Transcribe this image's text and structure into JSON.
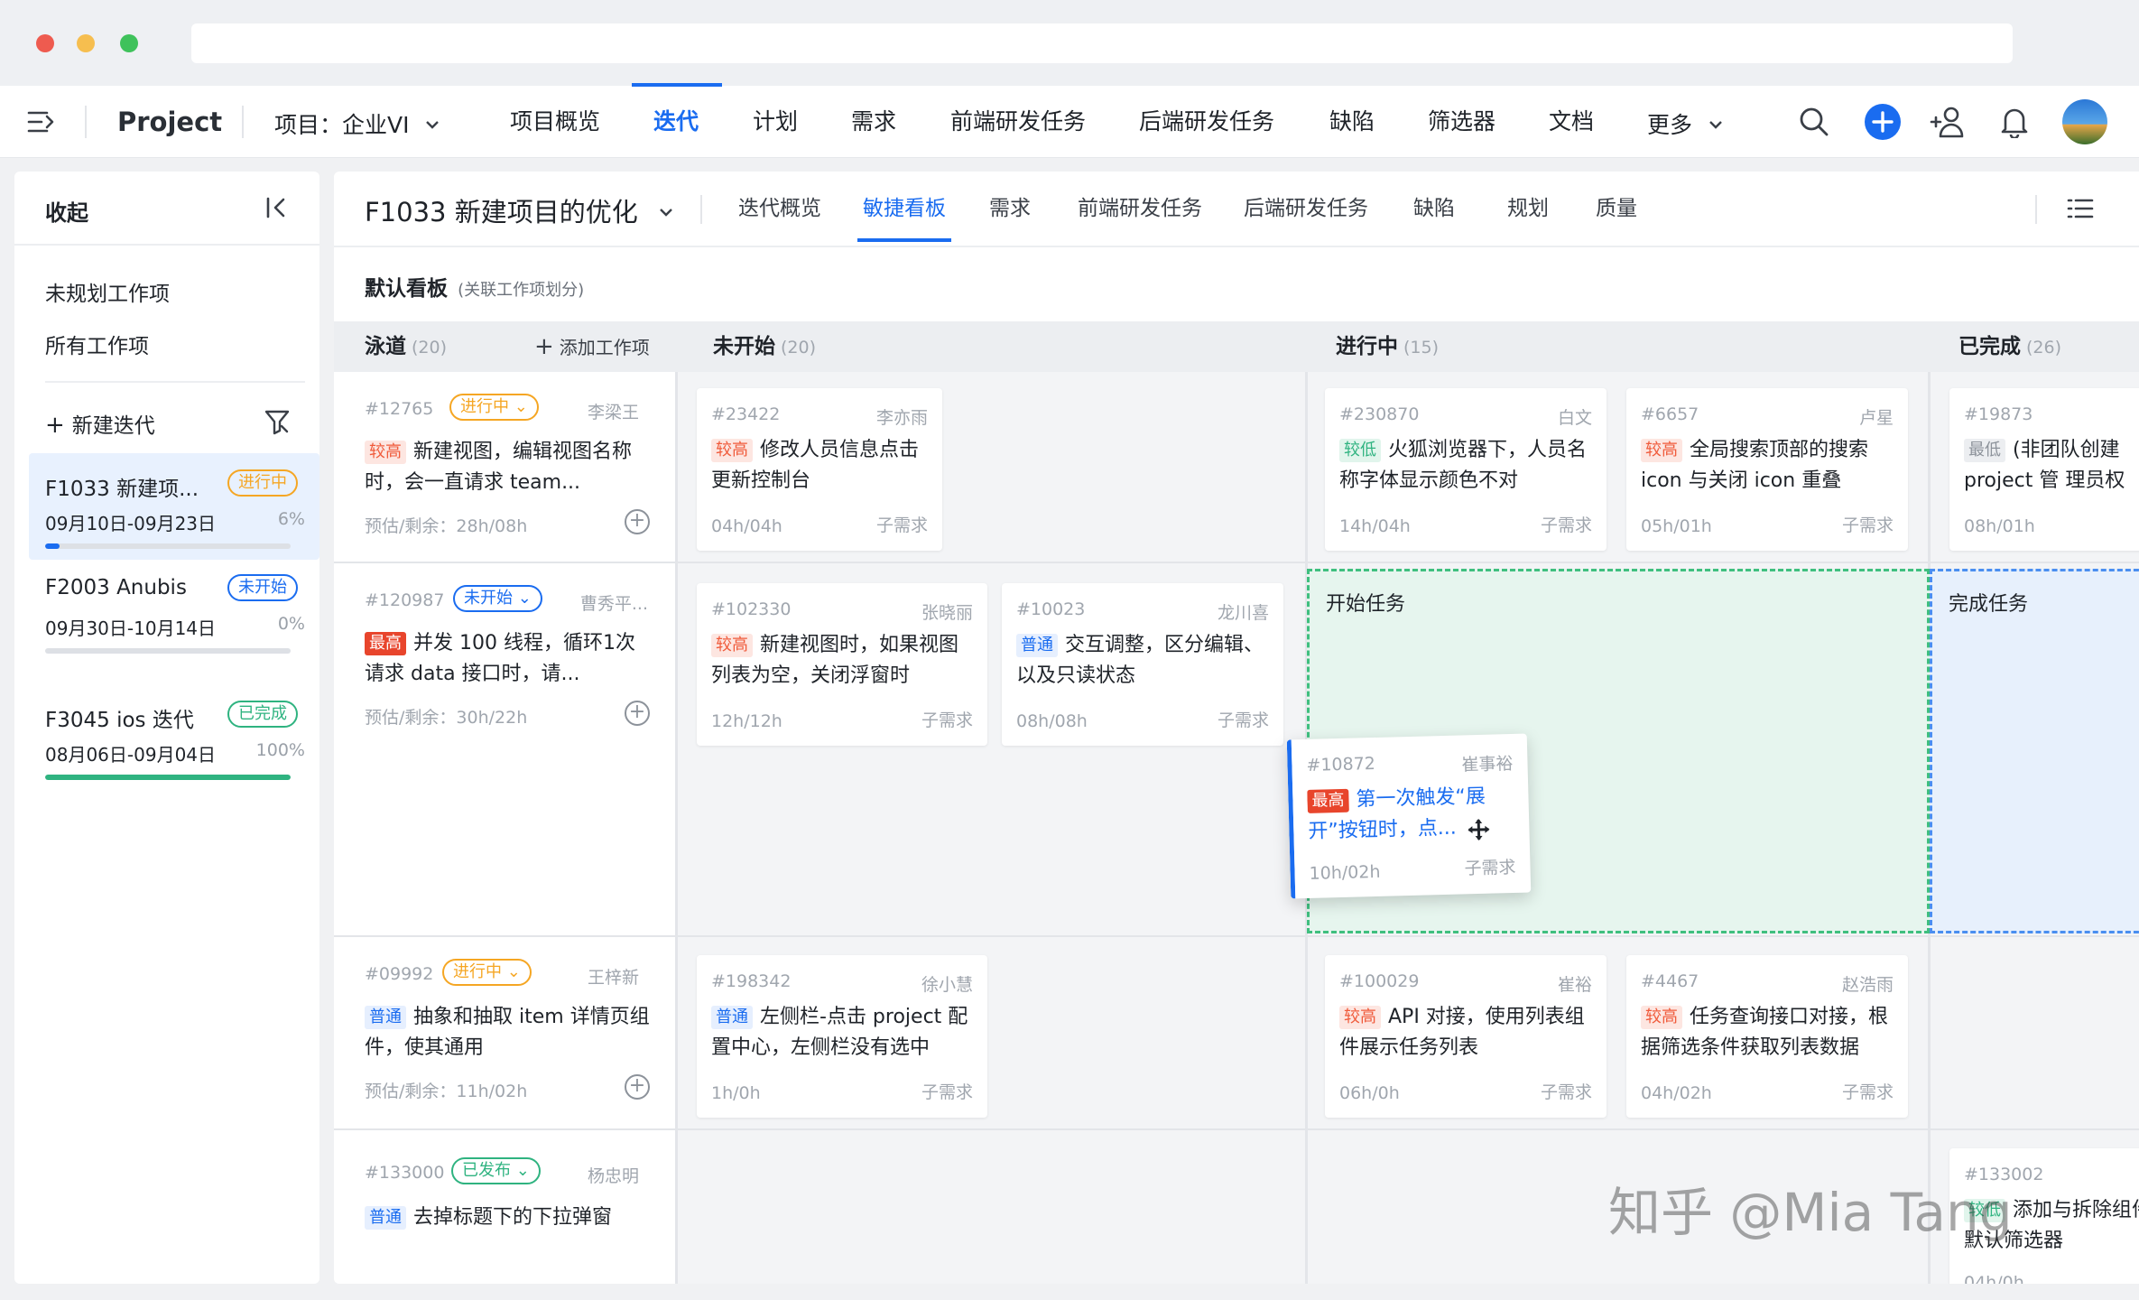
{
  "topnav": {
    "product": "Project",
    "project_selector": "项目：企业VI",
    "items": [
      "项目概览",
      "迭代",
      "计划",
      "需求",
      "前端研发任务",
      "后端研发任务",
      "缺陷",
      "筛选器",
      "文档",
      "更多"
    ],
    "active_item": "迭代",
    "accent": "#1a6cf0"
  },
  "sidebar": {
    "collapse_label": "收起",
    "links": [
      "未规划工作项",
      "所有工作项"
    ],
    "new_iteration": "新建迭代",
    "iterations": [
      {
        "name": "F1033 新建项...",
        "status": "进行中",
        "dates": "09月10日-09月23日",
        "percent": "6%",
        "progress": 0.06,
        "color": "#f5a623"
      },
      {
        "name": "F2003 Anubis",
        "status": "未开始",
        "dates": "09月30日-10月14日",
        "percent": "0%",
        "progress": 0,
        "color": "#1a6cf0"
      },
      {
        "name": "F3045 ios 迭代",
        "status": "已完成",
        "dates": "08月06日-09月04日",
        "percent": "100%",
        "progress": 1,
        "color": "#2fb380"
      }
    ]
  },
  "main": {
    "iteration_title": "F1033 新建项目的优化",
    "tabs": [
      "迭代概览",
      "敏捷看板",
      "需求",
      "前端研发任务",
      "后端研发任务",
      "缺陷",
      "规划",
      "质量"
    ],
    "active_tab": "敏捷看板",
    "board_title": "默认看板",
    "board_subtitle": "(关联工作项划分)"
  },
  "board": {
    "swimlane_header": "泳道",
    "swimlane_count": "(20)",
    "add_item": "添加工作项",
    "columns": [
      {
        "name": "未开始",
        "count": "(20)"
      },
      {
        "name": "进行中",
        "count": "(15)"
      },
      {
        "name": "已完成",
        "count": "(26)"
      }
    ],
    "lanes": [
      {
        "id": "#12765",
        "status": "进行中",
        "status_color": "#f5a623",
        "user": "李梁王",
        "priority": "较高",
        "pri_class": "pri-high",
        "title": "新建视图，编辑视图名称时，会一直请求 team...",
        "est": "预估/剩余：28h/08h"
      },
      {
        "id": "#120987",
        "status": "未开始",
        "status_color": "#1a6cf0",
        "user": "曹秀平...",
        "priority": "最高",
        "pri_class": "pri-top",
        "title": "并发 100 线程，循环1次请求 data 接口时，请...",
        "est": "预估/剩余：30h/22h"
      },
      {
        "id": "#09992",
        "status": "进行中",
        "status_color": "#f5a623",
        "user": "王梓新",
        "priority": "普通",
        "pri_class": "pri-normal",
        "title": "抽象和抽取 item 详情页组件，使其通用",
        "est": "预估/剩余：11h/02h"
      },
      {
        "id": "#133000",
        "status": "已发布",
        "status_color": "#2fb380",
        "user": "杨忠明",
        "priority": "普通",
        "pri_class": "pri-normal",
        "title": "去掉标题下的下拉弹窗",
        "est": ""
      }
    ],
    "cards": [
      {
        "id": "#23422",
        "user": "李亦雨",
        "priority": "较高",
        "pri_class": "pri-high",
        "title": "修改人员信息点击更新控制台",
        "hours": "04h/04h",
        "type": "子需求"
      },
      {
        "id": "#230870",
        "user": "白文",
        "priority": "较低",
        "pri_class": "pri-low",
        "title": "火狐浏览器下，人员名称字体显示颜色不对",
        "hours": "14h/04h",
        "type": "子需求"
      },
      {
        "id": "#6657",
        "user": "卢星",
        "priority": "较高",
        "pri_class": "pri-high",
        "title": "全局搜索顶部的搜索 icon 与关闭 icon 重叠",
        "hours": "05h/01h",
        "type": "子需求"
      },
      {
        "id": "#19873",
        "user": "",
        "priority": "最低",
        "pri_class": "pri-lowest",
        "title": "(非团队创建 project 管 理员权",
        "hours": "08h/01h",
        "type": ""
      },
      {
        "id": "#102330",
        "user": "张晓丽",
        "priority": "较高",
        "pri_class": "pri-high",
        "title": "新建视图时，如果视图列表为空，关闭浮窗时",
        "hours": "12h/12h",
        "type": "子需求"
      },
      {
        "id": "#10023",
        "user": "龙川喜",
        "priority": "普通",
        "pri_class": "pri-normal",
        "title": "交互调整，区分编辑、以及只读状态",
        "hours": "08h/08h",
        "type": "子需求"
      },
      {
        "id": "#10872",
        "user": "崔事裕",
        "priority": "最高",
        "pri_class": "pri-top",
        "title": "第一次触发“展开”按钮时，点...",
        "hours": "10h/02h",
        "type": "子需求"
      },
      {
        "id": "#198342",
        "user": "徐小慧",
        "priority": "普通",
        "pri_class": "pri-normal",
        "title": "左侧栏-点击 project 配置中心，左侧栏没有选中",
        "hours": "1h/0h",
        "type": "子需求"
      },
      {
        "id": "#100029",
        "user": "崔裕",
        "priority": "较高",
        "pri_class": "pri-high",
        "title": "API 对接，使用列表组件展示任务列表",
        "hours": "06h/0h",
        "type": "子需求"
      },
      {
        "id": "#4467",
        "user": "赵浩雨",
        "priority": "较高",
        "pri_class": "pri-high",
        "title": "任务查询接口对接，根据筛选条件获取列表数据",
        "hours": "04h/02h",
        "type": "子需求"
      },
      {
        "id": "#133002",
        "user": "",
        "priority": "较低",
        "pri_class": "pri-low",
        "title": "添加与拆除组件默认筛选器",
        "hours": "04h/0h",
        "type": ""
      }
    ],
    "dropzones": [
      "开始任务",
      "完成任务"
    ]
  },
  "watermark": "知乎 @Mia Tang"
}
